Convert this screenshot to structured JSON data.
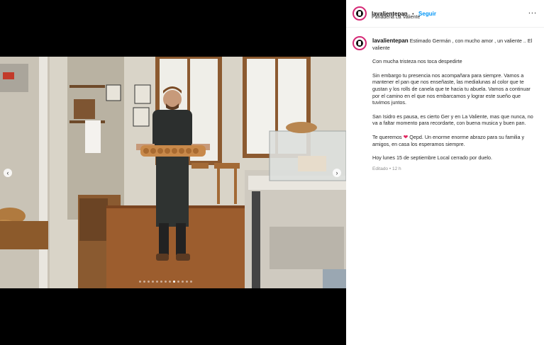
{
  "post": {
    "username": "lavalientepan",
    "follow_label": "Seguir",
    "separator": "•",
    "location": "Panaderia La Valiente",
    "more_label": "...",
    "caption": {
      "intro": "Estimado Germán , con mucho amor , un valiente .. El valiente",
      "p1": "Con mucha tristeza nos toca despedirte",
      "p2": "Sin embargo tu presencia nos acompañara para siempre. Vamos a mantener el pan que nos enseñaste, las medialunas al color que te gustan y los rolls de canela que te hacia tu abuela. Vamos a continuar por el camino en el que nos embarcamos y lograr este sueño que tuvimos juntos.",
      "p3": "San Isidro es pausa, es cierto Ger y en La Valiente, mas que nunca, no va a faltar momento para recordarte, con buena musica y buen pan.",
      "p4_before": "Te queremos",
      "heart": "❤",
      "p4_after": "Qepd. Un enorme enorme abrazo para su familia y amigos, en casa los esperamos siempre.",
      "p5": "Hoy lunes 15 de septiembre Local cerrado por duelo."
    },
    "edited_label": "Editado",
    "time_ago": "12 h"
  },
  "carousel": {
    "prev_icon": "‹",
    "next_icon": "›",
    "dot_count": 13,
    "active_dot": 8
  },
  "colors": {
    "follow": "#0095f6",
    "avatar_ring": "#d62976"
  }
}
